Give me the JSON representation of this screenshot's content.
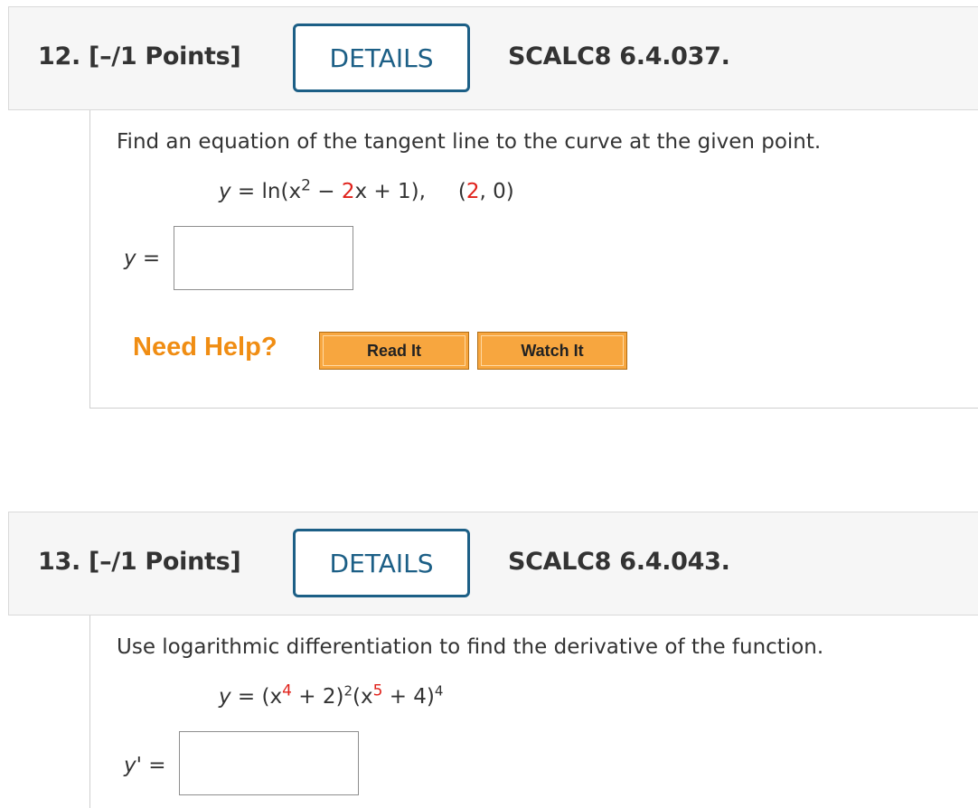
{
  "questions": [
    {
      "number_label": "12. [–/1 Points]",
      "details_label": "DETAILS",
      "code": "SCALC8 6.4.037.",
      "prompt": "Find an equation of the tangent line to the curve at the given point.",
      "equation": {
        "y": "y",
        "eq_open": " = ln(x",
        "exp": "2",
        "mid": " − ",
        "coef": "2",
        "rest": "x + 1),",
        "point_open": "(",
        "point_x": "2",
        "point_close": ", 0)"
      },
      "answer_label": "y",
      "answer_suffix": " =",
      "answer_value": "",
      "need_help": "Need Help?",
      "read_it": "Read It",
      "watch_it": "Watch It"
    },
    {
      "number_label": "13. [–/1 Points]",
      "details_label": "DETAILS",
      "code": "SCALC8 6.4.043.",
      "prompt": "Use logarithmic differentiation to find the derivative of the function.",
      "equation": {
        "y": "y",
        "eq_open": " = (x",
        "exp1": "4",
        "mid1": " + 2)",
        "exp2": "2",
        "mid2": "(x",
        "exp3": "5",
        "mid3": " + 4)",
        "exp4": "4"
      },
      "answer_label": "y'",
      "answer_suffix": " =",
      "answer_value": ""
    }
  ]
}
